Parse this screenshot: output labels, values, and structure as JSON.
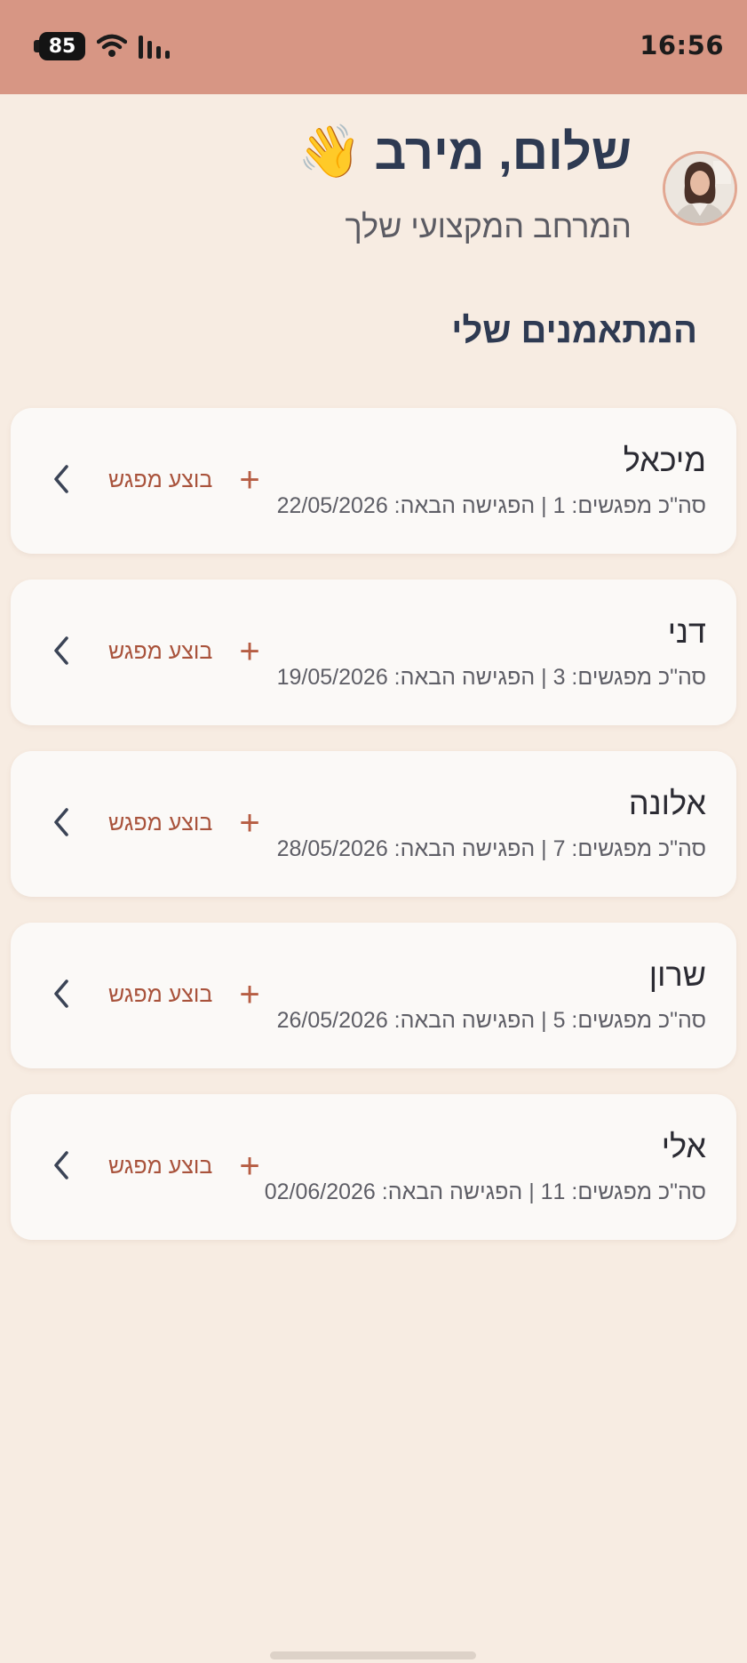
{
  "status_bar": {
    "time": "16:56",
    "battery": "85",
    "icons": [
      "battery-icon",
      "wifi-icon",
      "signal-icon"
    ]
  },
  "header": {
    "greeting": "שלום, מירב",
    "wave_emoji": "👋",
    "subtitle": "המרחב המקצועי שלך",
    "avatar": "avatar"
  },
  "section_title": "המתאמנים שלי",
  "clients": [
    {
      "name": "מיכאל",
      "meta": "סה\"כ מפגשים: 1 | הפגישה הבאה: 22/05/2026",
      "action": "בוצע מפגש"
    },
    {
      "name": "דני",
      "meta": "סה\"כ מפגשים: 3 | הפגישה הבאה: 19/05/2026",
      "action": "בוצע מפגש"
    },
    {
      "name": "אלונה",
      "meta": "סה\"כ מפגשים: 7 | הפגישה הבאה: 28/05/2026",
      "action": "בוצע מפגש"
    },
    {
      "name": "שרון",
      "meta": "סה\"כ מפגשים: 5 | הפגישה הבאה: 26/05/2026",
      "action": "בוצע מפגש"
    },
    {
      "name": "אלי",
      "meta": "סה\"כ מפגשים: 11 | הפגישה הבאה: 02/06/2026",
      "action": "בוצע מפגש"
    }
  ],
  "colors": {
    "status_bar": "#d79684",
    "background": "#f7ece2",
    "title": "#2e3a52",
    "accent": "#b65d43"
  }
}
